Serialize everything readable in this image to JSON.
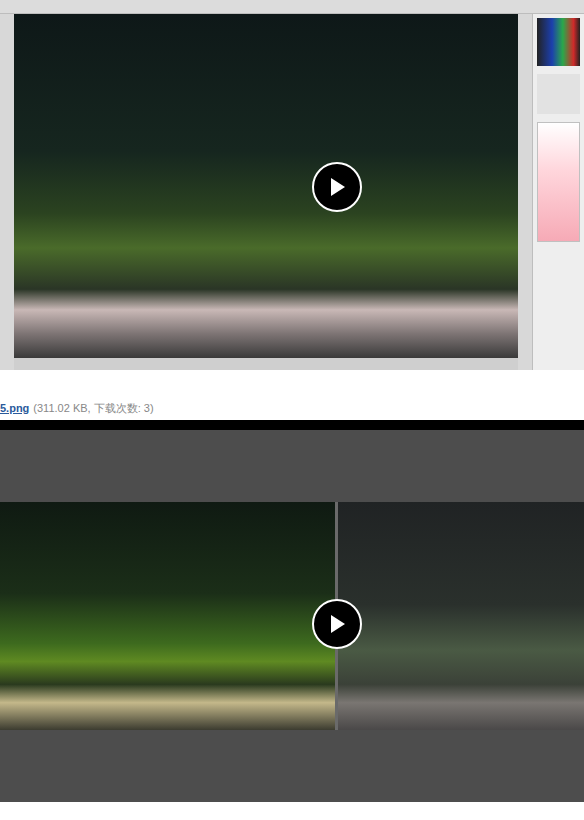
{
  "attachment": {
    "filename": "5.png",
    "info": "(311.02 KB, 下载次数: 3)"
  }
}
